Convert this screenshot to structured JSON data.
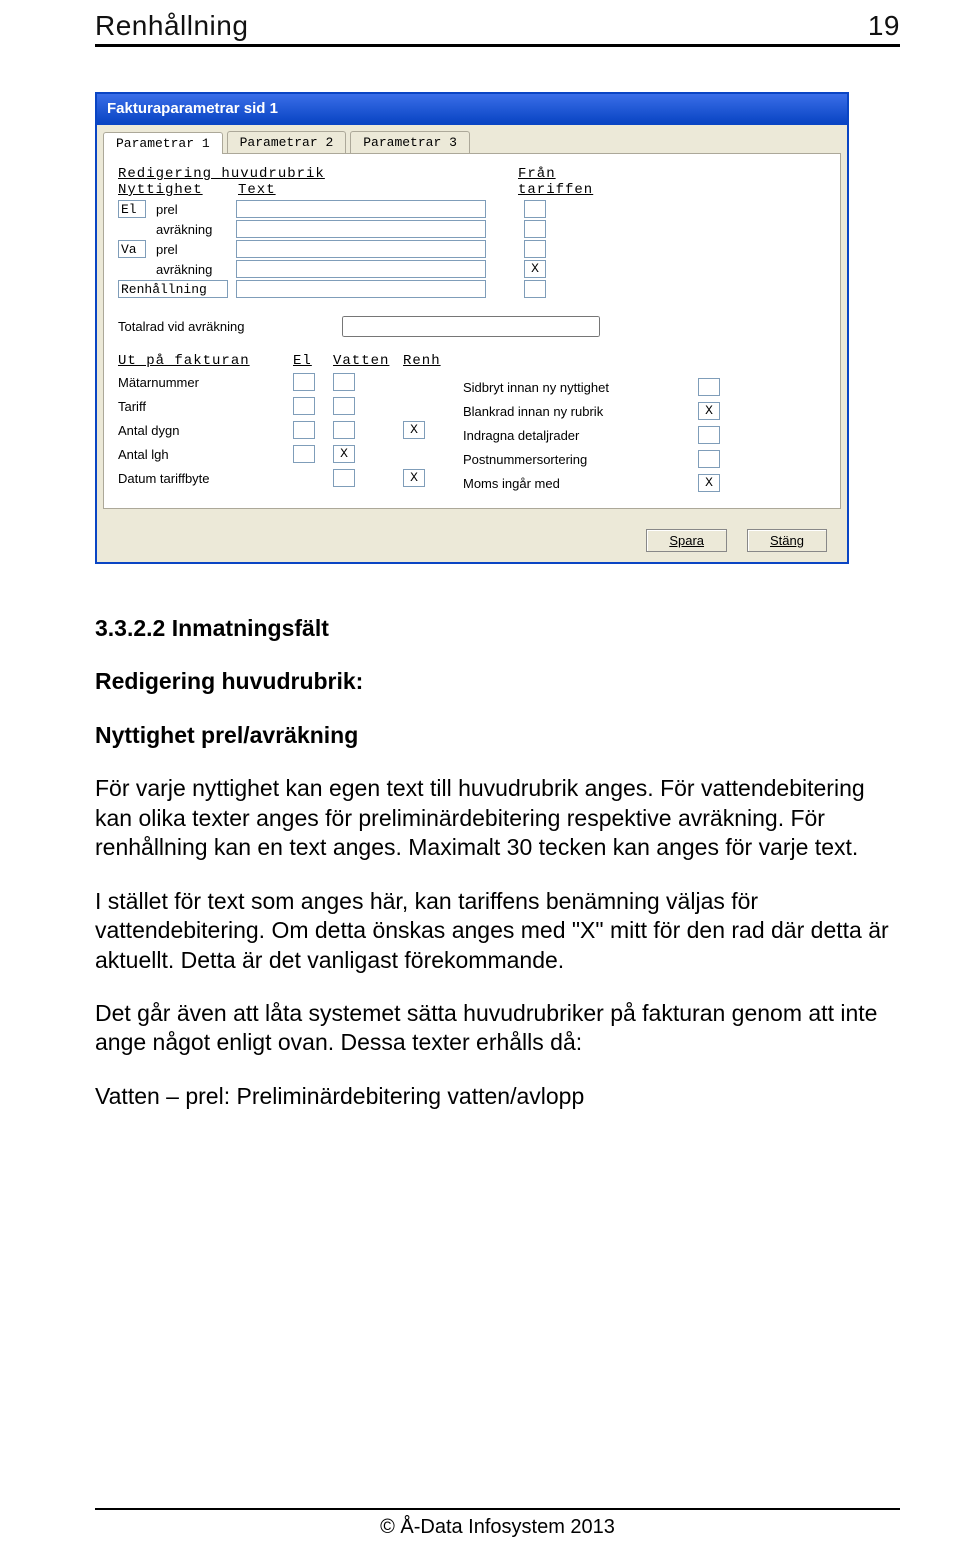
{
  "header": {
    "title": "Renhållning",
    "page_no": "19"
  },
  "window": {
    "title": "Fakturaparametrar sid 1",
    "tabs": [
      {
        "label": "Parametrar 1",
        "active": true
      },
      {
        "label": "Parametrar 2",
        "active": false
      },
      {
        "label": "Parametrar 3",
        "active": false
      }
    ],
    "section_title": "Redigering huvudrubrik",
    "cols": {
      "nyttighet": "Nyttighet",
      "text": "Text",
      "fran": "Från",
      "tariffen": "tariffen"
    },
    "rows": [
      {
        "code": "El",
        "label_a": "prel",
        "label_b": "avräkning",
        "fran": ""
      },
      {
        "code": "Va",
        "label_a": "prel",
        "label_b": "avräkning",
        "fran": "X"
      },
      {
        "code_wide": "Renhållning",
        "fran": ""
      }
    ],
    "totalrad_label": "Totalrad vid avräkning",
    "left_cols": {
      "utpa": "Ut på fakturan",
      "el": "El",
      "vatten": "Vatten",
      "renh": "Renh"
    },
    "left_rows": [
      {
        "lab": "Mätarnummer",
        "el": "",
        "vatten": "",
        "renh": ""
      },
      {
        "lab": "Tariff",
        "el": "",
        "vatten": "",
        "renh": ""
      },
      {
        "lab": "Antal dygn",
        "el": "",
        "vatten": "",
        "renh": "X"
      },
      {
        "lab": "Antal lgh",
        "el": "",
        "vatten": "X",
        "renh": ""
      },
      {
        "lab": "Datum tariffbyte",
        "el": "",
        "vatten": "",
        "renh": "X"
      }
    ],
    "right_rows": [
      {
        "lab": "Sidbryt innan ny nyttighet",
        "val": ""
      },
      {
        "lab": "Blankrad innan ny rubrik",
        "val": "X"
      },
      {
        "lab": "Indragna detaljrader",
        "val": ""
      },
      {
        "lab": "Postnummersortering",
        "val": ""
      },
      {
        "lab": "Moms ingår med",
        "val": "X"
      }
    ],
    "buttons": {
      "save": "Spara",
      "close": "Stäng"
    }
  },
  "body": {
    "h2": "3.3.2.2 Inmatningsfält",
    "h3": "Redigering huvudrubrik:",
    "h4": "Nyttighet prel/avräkning",
    "p1": "För varje nyttighet kan egen text till huvudrubrik anges. För vattendebitering kan olika texter anges för preliminärdebitering respektive avräkning. För renhållning kan en text anges. Maximalt 30 tecken kan anges för varje text.",
    "p2": "I stället för text som anges här, kan tariffens benämning väljas för vattendebitering. Om detta önskas anges med \"X\" mitt för den rad där detta är aktuellt. Detta är det vanligast förekommande.",
    "p3": "Det går även att låta systemet sätta huvudrubriker på fakturan genom att inte ange något enligt ovan. Dessa texter erhålls då:",
    "p4": "Vatten – prel: Preliminärdebitering vatten/avlopp"
  },
  "footer": {
    "copyright": "© Å-Data Infosystem 2013"
  }
}
